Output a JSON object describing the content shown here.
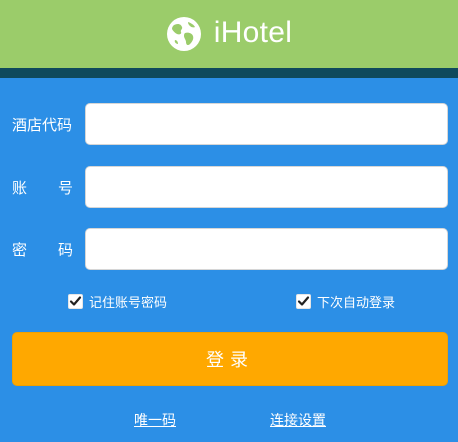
{
  "header": {
    "title": "iHotel",
    "logo_icon": "globe-icon",
    "background": "#9bcc6a",
    "bar_color": "#0f4a5c"
  },
  "form": {
    "hotel_code": {
      "label": "酒店代码",
      "value": "",
      "placeholder": ""
    },
    "account": {
      "label_left": "账",
      "label_right": "号",
      "value": "",
      "placeholder": ""
    },
    "password": {
      "label_left": "密",
      "label_right": "码",
      "value": "",
      "placeholder": ""
    }
  },
  "options": {
    "remember_password": {
      "label": "记住账号密码",
      "checked": true
    },
    "auto_login": {
      "label": "下次自动登录",
      "checked": true
    }
  },
  "login_button": {
    "label": "登录",
    "color": "#ffa800"
  },
  "links": {
    "unique_code": "唯一码",
    "connection_settings": "连接设置"
  },
  "background": "#2c8fe6"
}
